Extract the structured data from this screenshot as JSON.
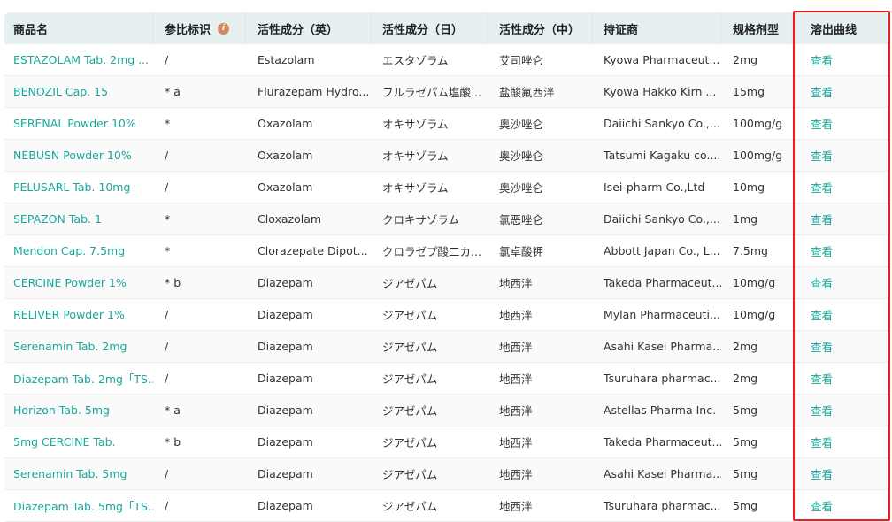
{
  "table": {
    "headers": [
      "商品名",
      "参比标识",
      "活性成分（英）",
      "活性成分（日）",
      "活性成分（中）",
      "持证商",
      "规格剂型",
      "溶出曲线"
    ],
    "info_icon": "info-icon",
    "accent_color": "#1aa79b",
    "rows": [
      [
        "ESTAZOLAM Tab. 2mg ...",
        "/",
        "Estazolam",
        "エスタゾラム",
        "艾司唑仑",
        "Kyowa Pharmaceut...",
        "2mg",
        "查看"
      ],
      [
        "BENOZIL Cap. 15",
        " * a",
        "Flurazepam Hydro...",
        "フルラゼパム塩酸...",
        "盐酸氟西泮",
        "Kyowa Hakko Kirn ...",
        "15mg",
        "查看"
      ],
      [
        "SERENAL Powder 10%",
        " *",
        "Oxazolam",
        "オキサゾラム",
        "奥沙唑仑",
        "Daiichi Sankyo Co.,...",
        "100mg/g",
        "查看"
      ],
      [
        "NEBUSN Powder 10%",
        "/",
        "Oxazolam",
        "オキサゾラム",
        "奥沙唑仑",
        "Tatsumi Kagaku co....",
        "100mg/g",
        "查看"
      ],
      [
        "PELUSARL Tab. 10mg",
        "/",
        "Oxazolam",
        "オキサゾラム",
        "奥沙唑仑",
        "Isei-pharm Co.,Ltd",
        "10mg",
        "查看"
      ],
      [
        "SEPAZON Tab.  1",
        " *",
        "Cloxazolam",
        "クロキサゾラム",
        "氯恶唑仑",
        "Daiichi Sankyo Co.,...",
        "1mg",
        "查看"
      ],
      [
        "Mendon Cap. 7.5mg",
        " *",
        "Clorazepate Dipot...",
        "クロラゼプ酸二カ...",
        "氯卓酸钾",
        "Abbott Japan Co., L...",
        "7.5mg",
        "查看"
      ],
      [
        "CERCINE Powder 1%",
        " * b",
        "Diazepam",
        "ジアゼパム",
        "地西泮",
        "Takeda Pharmaceut...",
        "10mg/g",
        "查看"
      ],
      [
        "RELIVER Powder 1%",
        "/",
        "Diazepam",
        "ジアゼパム",
        "地西泮",
        "Mylan Pharmaceuti...",
        "10mg/g",
        "查看"
      ],
      [
        "Serenamin Tab. 2mg",
        "/",
        "Diazepam",
        "ジアゼパム",
        "地西泮",
        "Asahi Kasei Pharma...",
        "2mg",
        "查看"
      ],
      [
        "Diazepam Tab. 2mg「TS...",
        "/",
        "Diazepam",
        "ジアゼパム",
        "地西泮",
        "Tsuruhara pharmac...",
        "2mg",
        "查看"
      ],
      [
        "Horizon Tab. 5mg",
        " * a",
        "Diazepam",
        "ジアゼパム",
        "地西泮",
        "Astellas Pharma Inc.",
        "5mg",
        "查看"
      ],
      [
        "5mg CERCINE Tab.",
        " * b",
        "Diazepam",
        "ジアゼパム",
        "地西泮",
        "Takeda Pharmaceut...",
        "5mg",
        "查看"
      ],
      [
        "Serenamin Tab. 5mg",
        "/",
        "Diazepam",
        "ジアゼパム",
        "地西泮",
        "Asahi Kasei Pharma...",
        "5mg",
        "查看"
      ],
      [
        "Diazepam Tab. 5mg「TS...",
        "/",
        "Diazepam",
        "ジアゼパム",
        "地西泮",
        "Tsuruhara pharmac...",
        "5mg",
        "查看"
      ]
    ]
  }
}
